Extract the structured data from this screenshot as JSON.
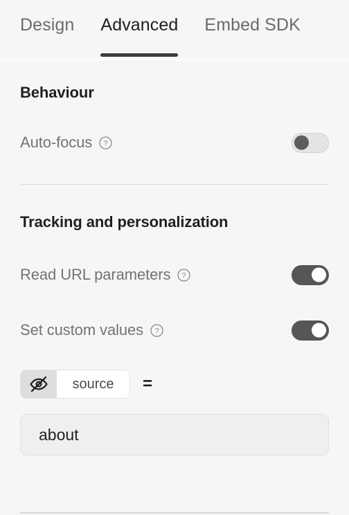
{
  "tabs": [
    {
      "label": "Design",
      "active": false
    },
    {
      "label": "Advanced",
      "active": true
    },
    {
      "label": "Embed SDK",
      "active": false
    }
  ],
  "sections": {
    "behaviour": {
      "title": "Behaviour",
      "rows": [
        {
          "label": "Auto-focus",
          "help": "help-icon",
          "toggle": "off"
        }
      ]
    },
    "tracking": {
      "title": "Tracking and personalization",
      "rows": [
        {
          "label": "Read URL parameters",
          "help": "help-icon",
          "toggle": "on"
        },
        {
          "label": "Set custom values",
          "help": "help-icon",
          "toggle": "on"
        }
      ],
      "parameter": {
        "visibility_icon": "eye-off-icon",
        "key_value": "source",
        "key_placeholder": "key",
        "equals": "=",
        "value": "about",
        "value_placeholder": "value"
      }
    }
  },
  "colors": {
    "background": "#f6f6f4",
    "toggle_on_track": "#565656",
    "toggle_off_track": "#e4e4e2",
    "active_tab_underline": "#3c3c3c",
    "label_text": "#737373",
    "heading_text": "#1f1f1f"
  }
}
